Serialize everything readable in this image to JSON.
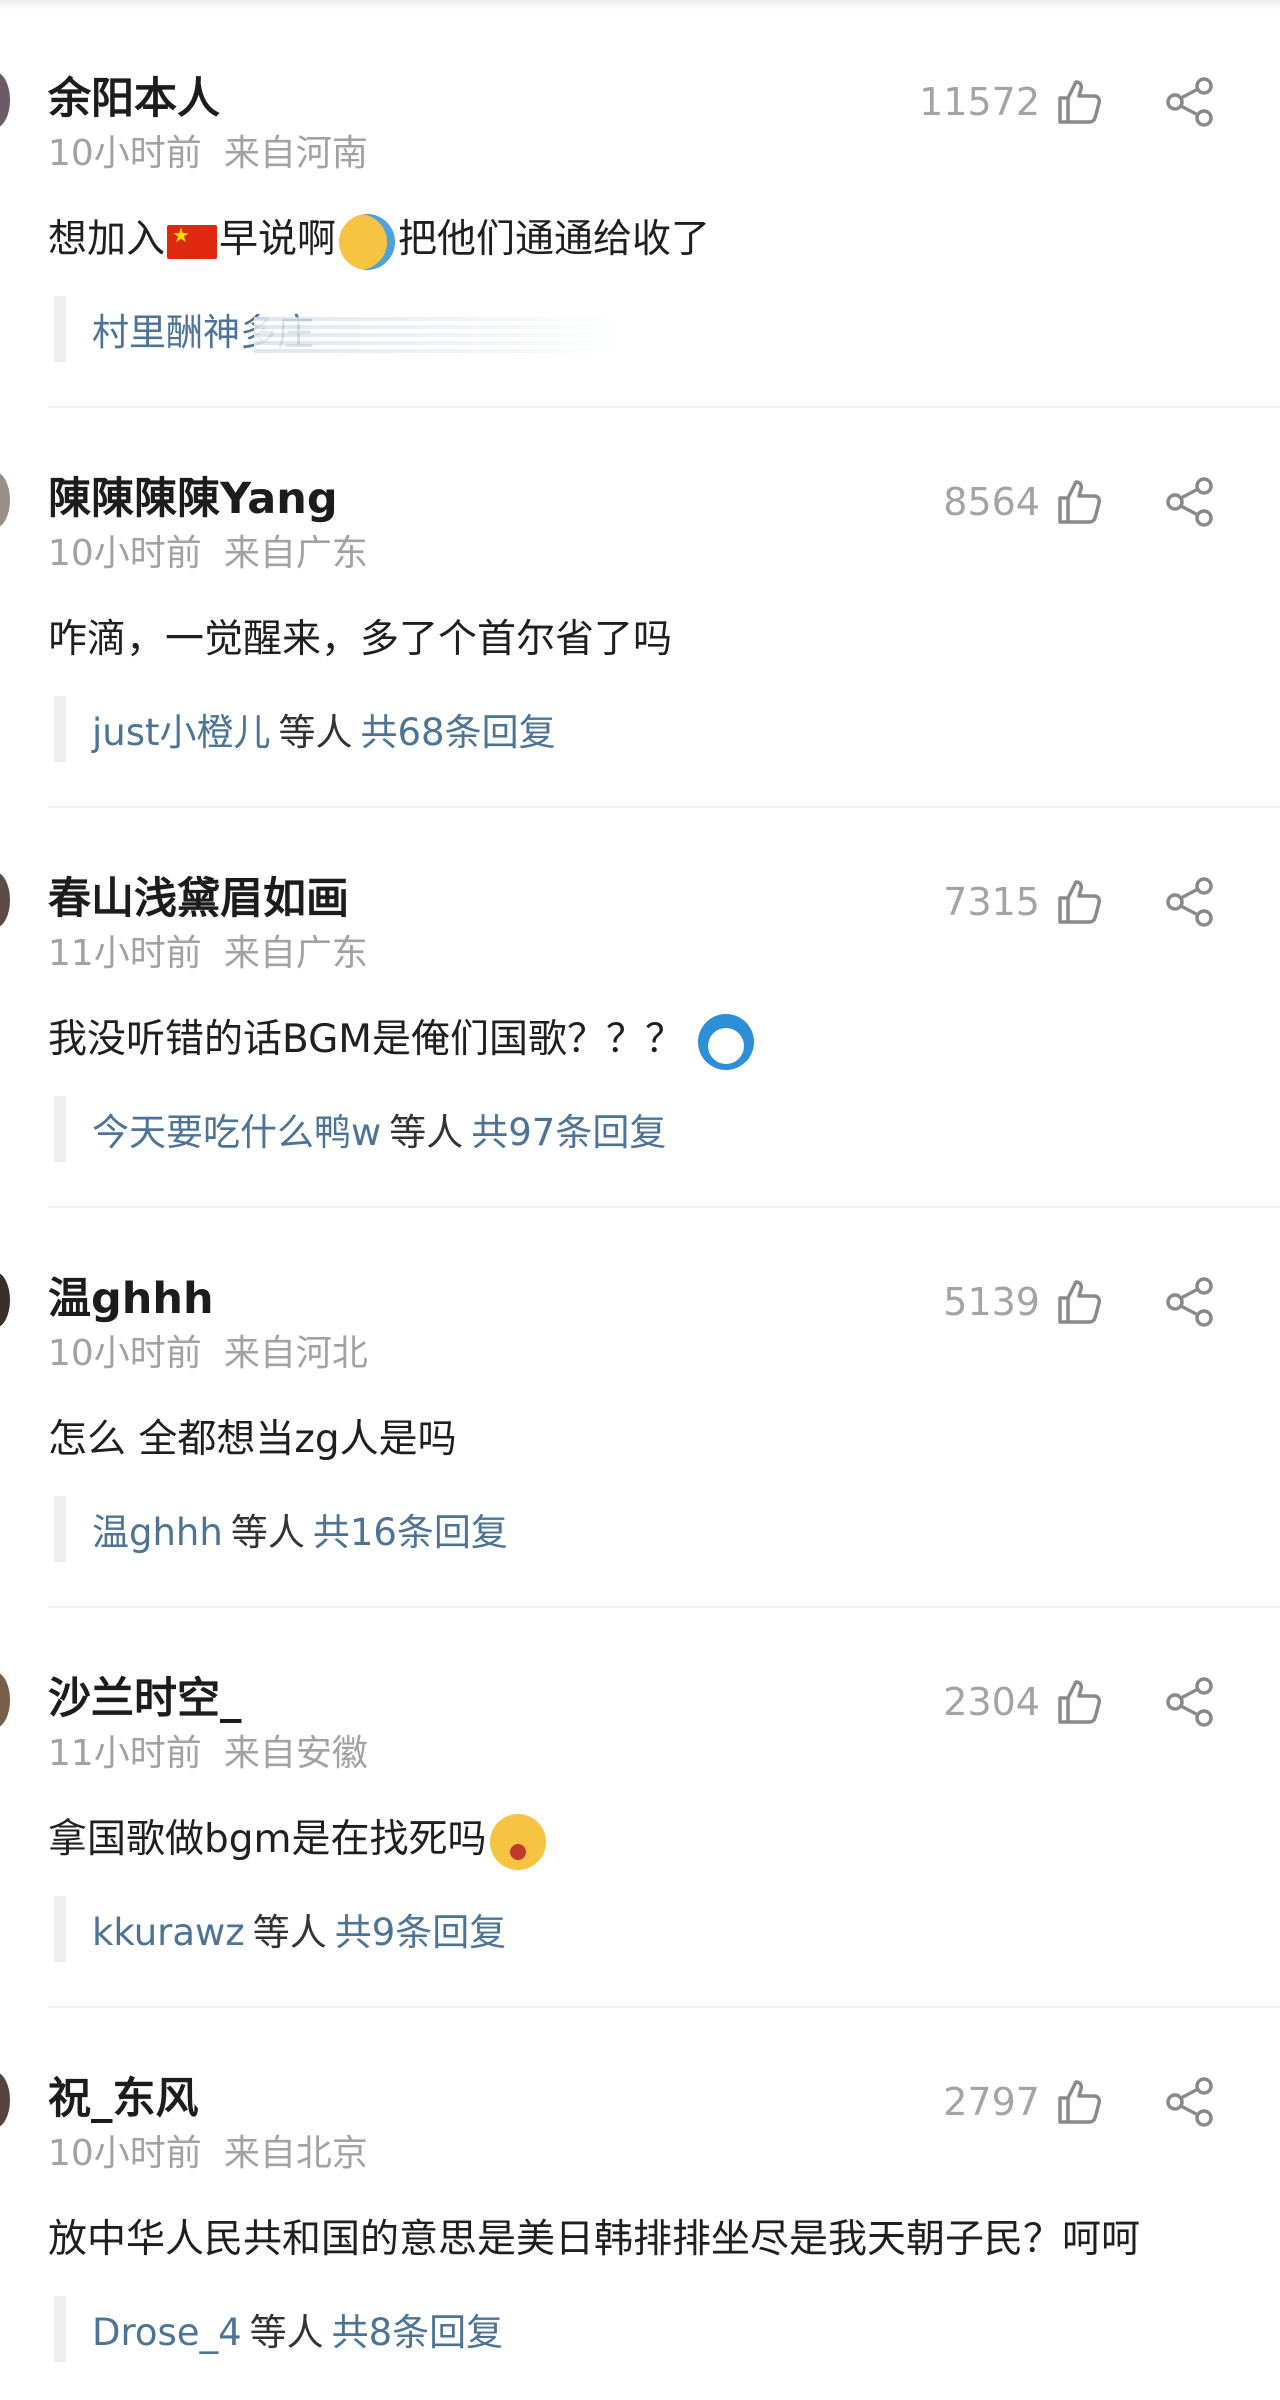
{
  "comments": [
    {
      "username": "余阳本人",
      "time": "10小时前",
      "location": "来自河南",
      "likes": "11572",
      "text_parts": [
        "想加入",
        "早说啊",
        "把他们通通给收了"
      ],
      "emojis": [
        "china-flag",
        "crying-laughing-face"
      ],
      "reply_user": "村里酬神多庄",
      "reply_suffix": "",
      "reply_total": ""
    },
    {
      "username": "陳陳陳陳Yang",
      "time": "10小时前",
      "location": "来自广东",
      "likes": "8564",
      "text": "咋滴，一觉醒来，多了个首尔省了吗",
      "reply_user": "just小橙儿",
      "reply_suffix": "等人",
      "reply_total": "共68条回复"
    },
    {
      "username": "春山浅黛眉如画",
      "time": "11小时前",
      "location": "来自广东",
      "likes": "7315",
      "text": "我没听错的话BGM是俺们国歌？？？",
      "emojis": [
        "doraemon-face"
      ],
      "reply_user": "今天要吃什么鸭w",
      "reply_suffix": "等人",
      "reply_total": "共97条回复"
    },
    {
      "username": "温ghhh",
      "time": "10小时前",
      "location": "来自河北",
      "likes": "5139",
      "text": "怎么 全都想当zg人是吗",
      "reply_user": "温ghhh",
      "reply_suffix": "等人",
      "reply_total": "共16条回复"
    },
    {
      "username": "沙兰时空_",
      "time": "11小时前",
      "location": "来自安徽",
      "likes": "2304",
      "text": "拿国歌做bgm是在找死吗",
      "emojis": [
        "shocked-face"
      ],
      "reply_user": "kkurawz",
      "reply_suffix": "等人",
      "reply_total": "共9条回复"
    },
    {
      "username": "祝_东风",
      "time": "10小时前",
      "location": "来自北京",
      "likes": "2797",
      "text": "放中华人民共和国的意思是美日韩排排坐尽是我天朝子民？呵呵",
      "reply_user": "Drose_4",
      "reply_suffix": "等人",
      "reply_total": "共8条回复"
    }
  ],
  "icons": {
    "like": "thumbs-up-icon",
    "share": "share-icon"
  },
  "colors": {
    "reply_link": "#4d7396",
    "meta_gray": "#a2a2a2"
  }
}
